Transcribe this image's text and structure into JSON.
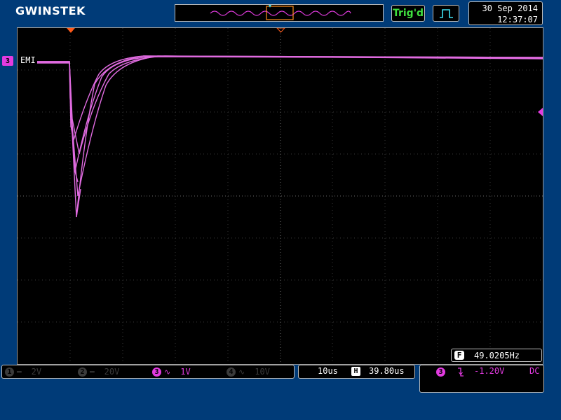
{
  "brand": {
    "logo": "GWINSTEK"
  },
  "trigger": {
    "status": "Trig'd",
    "mode_icon": "pulse-trigger-icon"
  },
  "datetime": {
    "date": "30 Sep 2014",
    "time": "12:37:07"
  },
  "waveform": {
    "channel_number": "3",
    "channel_label": "EMI",
    "trace_color": "#e23be0"
  },
  "frequency": {
    "badge": "F",
    "value": "49.0205Hz"
  },
  "channels": [
    {
      "num": "1",
      "coupling": "DC",
      "scale": "2V",
      "active": false
    },
    {
      "num": "2",
      "coupling": "DC",
      "scale": "20V",
      "active": false
    },
    {
      "num": "3",
      "coupling": "AC",
      "scale": "1V",
      "active": true
    },
    {
      "num": "4",
      "coupling": "AC",
      "scale": "10V",
      "active": false
    }
  ],
  "timebase": {
    "scale": "10us",
    "h_badge": "H",
    "position": "39.80us"
  },
  "trigger_info": {
    "source": "3",
    "slope_icon": "falling-edge-icon",
    "level": "-1.20V",
    "coupling": "DC"
  },
  "colors": {
    "background": "#003b78",
    "grid": "#000000",
    "channel3": "#e23be0",
    "trig_status": "#3fe03f"
  }
}
